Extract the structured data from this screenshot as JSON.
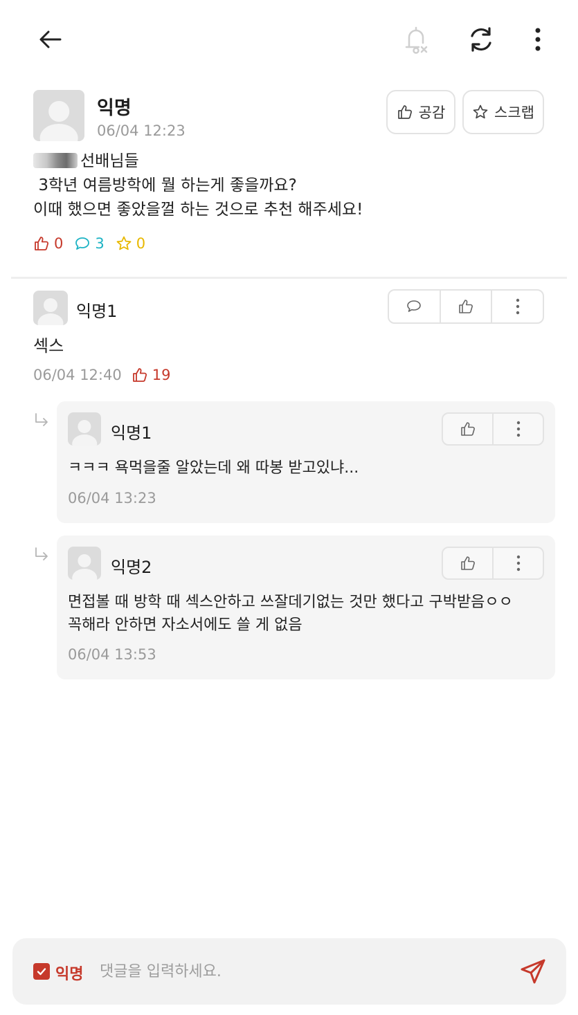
{
  "header": {
    "icons": [
      "back-arrow-icon",
      "bell-off-icon",
      "refresh-icon",
      "more-vertical-icon"
    ]
  },
  "post": {
    "author": "익명",
    "time": "06/04 12:23",
    "like_button_label": "공감",
    "scrap_button_label": "스크랩",
    "body_line1": "선배님들",
    "body_line2": " 3학년 여름방학에 뭘 하는게 좋을까요?",
    "body_line3": "이때 했으면 좋았을껄 하는 것으로 추천 해주세요!",
    "stats": {
      "likes": "0",
      "comments": "3",
      "scraps": "0"
    }
  },
  "comments": [
    {
      "author": "익명1",
      "body": "섹스",
      "time": "06/04 12:40",
      "likes": "19",
      "replies": [
        {
          "author": "익명1",
          "body": "ㅋㅋㅋ 욕먹을줄 알았는데 왜 따봉 받고있냐...",
          "time": "06/04 13:23"
        },
        {
          "author": "익명2",
          "body": "면접볼 때 방학 때 섹스안하고 쓰잘데기없는 것만 했다고 구박받음ㅇㅇ\n꼭해라 안하면 자소서에도 쓸 게 없음",
          "time": "06/04 13:53"
        }
      ]
    }
  ],
  "composer": {
    "anonymous_label": "익명",
    "anonymous_checked": true,
    "placeholder": "댓글을 입력하세요."
  },
  "colors": {
    "accent_red": "#c6392b",
    "comment_teal": "#1db3c4",
    "scrap_yellow": "#e8b800",
    "muted_text": "#9a9a9a"
  }
}
